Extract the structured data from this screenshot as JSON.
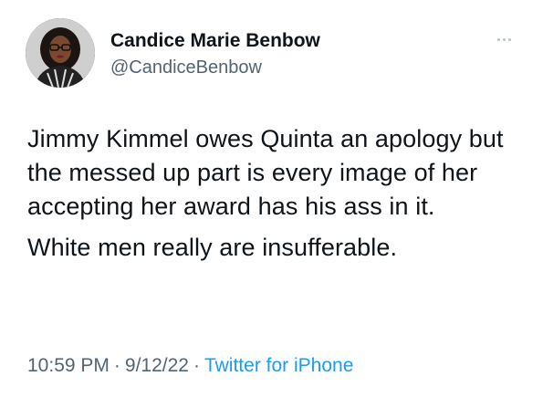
{
  "author": {
    "display_name": "Candice Marie Benbow",
    "handle": "@CandiceBenbow",
    "avatar_icon": "profile-photo"
  },
  "tweet": {
    "paragraphs": [
      "Jimmy Kimmel owes Quinta an apology but the messed up part is every image of her accepting her award has his ass in it.",
      "White men really are insufferable."
    ]
  },
  "meta": {
    "time": "10:59 PM",
    "date": "9/12/22",
    "separator": "·",
    "source": "Twitter for iPhone"
  },
  "menu": {
    "icon": "more-dots-icon"
  },
  "colors": {
    "text": "#0f1419",
    "secondary": "#536471",
    "link": "#1d9bf0"
  }
}
